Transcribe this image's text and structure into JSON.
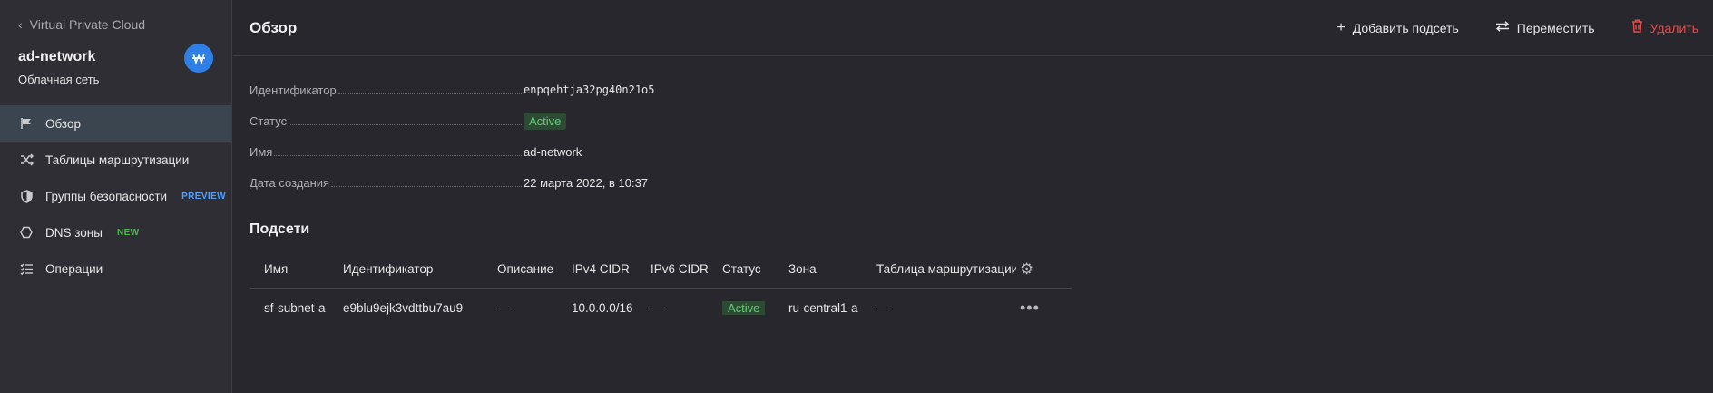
{
  "sidebar": {
    "back_label": "Virtual Private Cloud",
    "resource_name": "ad-network",
    "resource_type": "Облачная сеть",
    "service_icon": "vpc-network-icon",
    "items": [
      {
        "label": "Обзор",
        "icon": "flag-icon",
        "active": true
      },
      {
        "label": "Таблицы маршрутизации",
        "icon": "shuffle-icon"
      },
      {
        "label": "Группы безопасности",
        "icon": "shield-icon",
        "tag": "PREVIEW"
      },
      {
        "label": "DNS зоны",
        "icon": "hexagon-icon",
        "tag": "NEW"
      },
      {
        "label": "Операции",
        "icon": "list-icon"
      }
    ]
  },
  "header": {
    "title": "Обзор",
    "actions": {
      "add_subnet": "Добавить подсеть",
      "move": "Переместить",
      "delete": "Удалить"
    }
  },
  "properties": [
    {
      "label": "Идентификатор",
      "value": "enpqehtja32pg40n21o5"
    },
    {
      "label": "Статус",
      "value": "Active"
    },
    {
      "label": "Имя",
      "value": "ad-network"
    },
    {
      "label": "Дата создания",
      "value": "22 марта 2022, в 10:37"
    }
  ],
  "subnets": {
    "title": "Подсети",
    "columns": [
      "Имя",
      "Идентификатор",
      "Описание",
      "IPv4 CIDR",
      "IPv6 CIDR",
      "Статус",
      "Зона",
      "Таблица маршрутизации"
    ],
    "rows": [
      [
        "sf-subnet-a",
        "e9blu9ejk3vdttbu7au9",
        "—",
        "10.0.0.0/16",
        "—",
        "Active",
        "ru-central1-a",
        "—"
      ]
    ]
  },
  "colors": {
    "accent": "#2f80e6",
    "active_badge_text": "#5fcf70",
    "delete": "#e04e4e"
  }
}
